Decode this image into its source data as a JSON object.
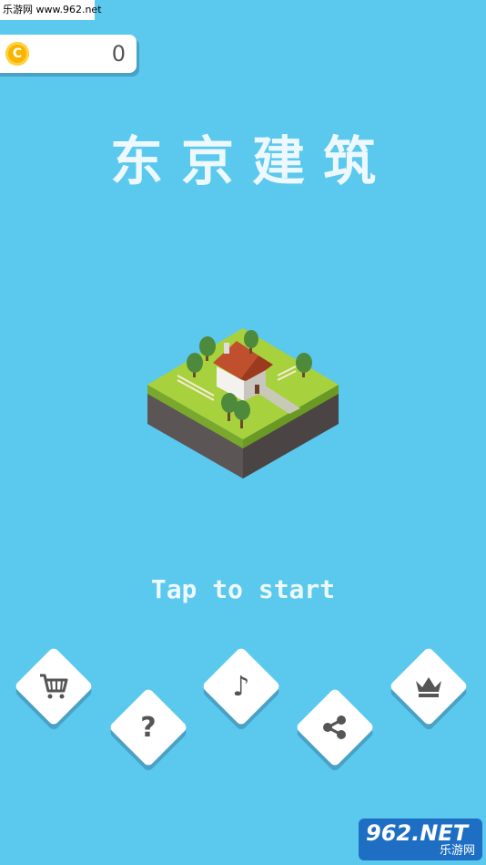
{
  "watermark_top": "乐游网 www.962.net",
  "coins": {
    "icon": "coin-icon",
    "symbol": "C",
    "count": "0"
  },
  "title": "东京建筑",
  "start_prompt": "Tap to start",
  "buttons": [
    {
      "id": "shop",
      "icon": "cart-icon"
    },
    {
      "id": "help",
      "icon": "question-icon",
      "glyph": "?"
    },
    {
      "id": "music",
      "icon": "music-note-icon",
      "glyph": "♪"
    },
    {
      "id": "share",
      "icon": "share-icon"
    },
    {
      "id": "leaderboard",
      "icon": "crown-icon"
    }
  ],
  "watermark_bottom": {
    "big": "962.NET",
    "small": "乐游网"
  },
  "colors": {
    "sky": "#5bc8ee",
    "grass": "#9ccc3c",
    "roof": "#c0502d",
    "coin": "#f7b500"
  }
}
